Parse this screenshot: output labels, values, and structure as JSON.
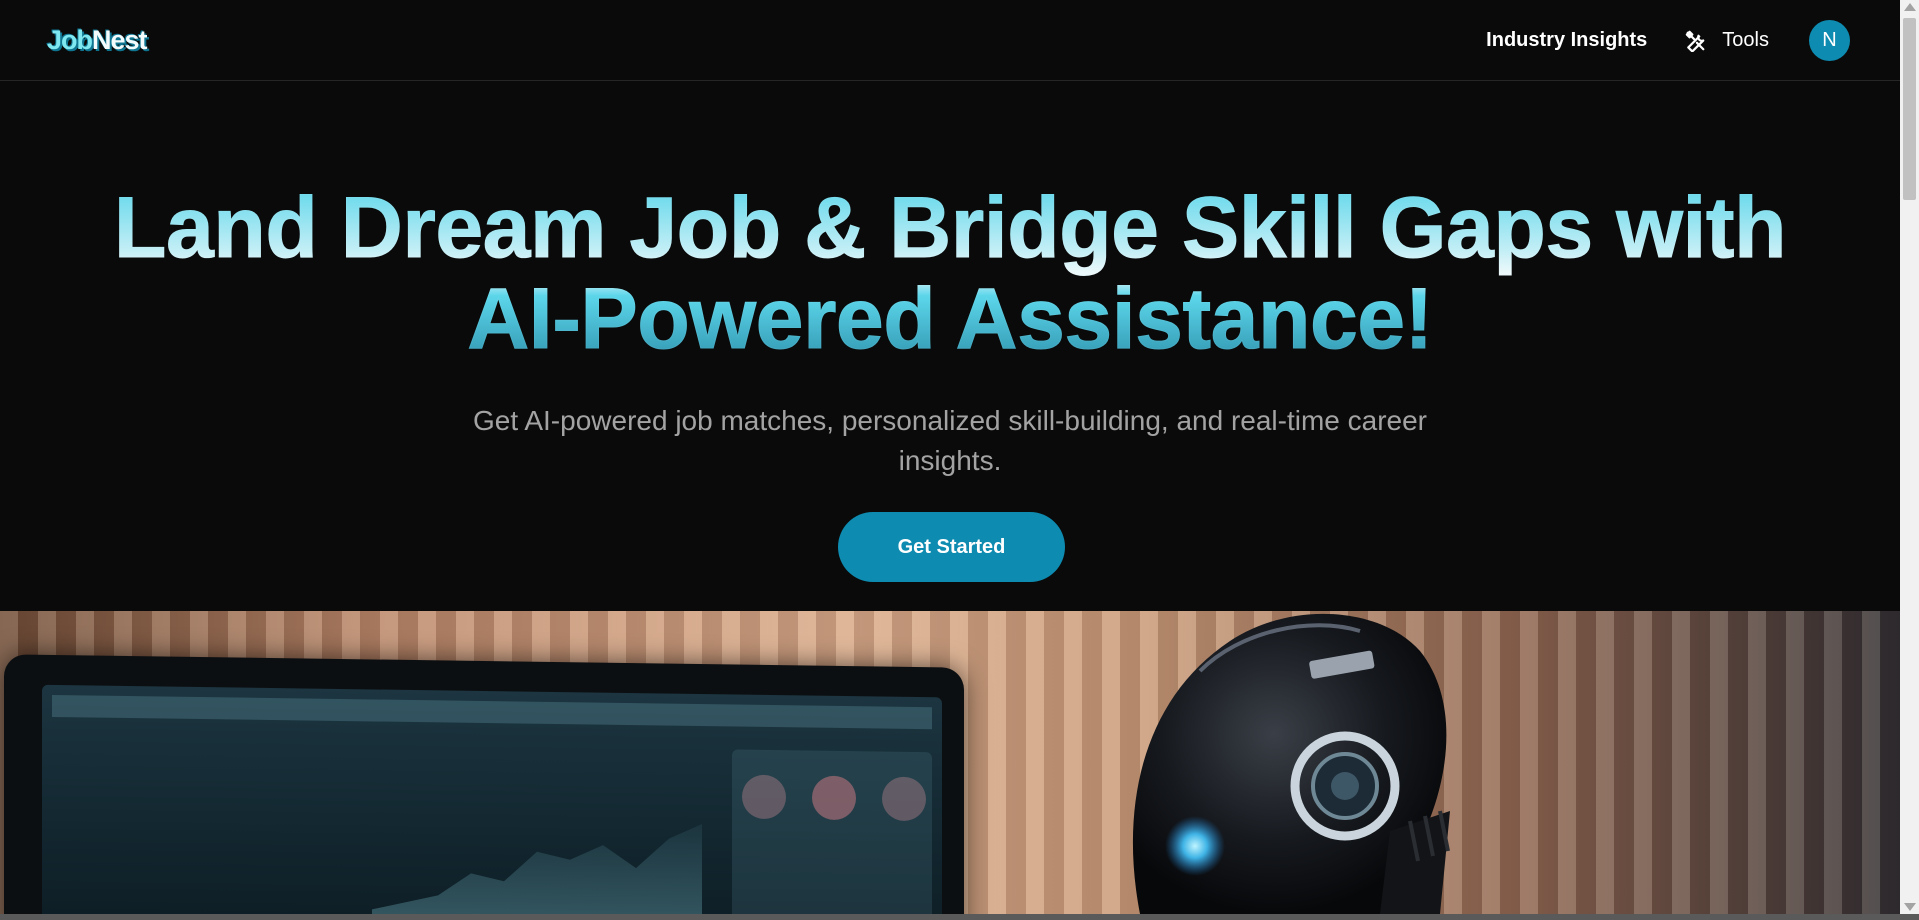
{
  "colors": {
    "background": "#0a0a0a",
    "accent": "#0e8bb0",
    "title_gradient_light": "#eef9fb",
    "title_gradient_cyan": "#5cd6ea",
    "subtitle": "#a3a3a3"
  },
  "navbar": {
    "logo_part1": "Job",
    "logo_part2": "Nest",
    "links": {
      "industry_insights": "Industry Insights",
      "tools": "Tools"
    },
    "tools_icon": "tools-icon",
    "avatar_initial": "N"
  },
  "hero": {
    "title_line1": "Land Dream Job & Bridge Skill Gaps with",
    "title_line2": "AI-Powered Assistance!",
    "subtitle": "Get AI-powered job matches, personalized skill-building, and real-time career insights.",
    "cta_label": "Get Started"
  }
}
